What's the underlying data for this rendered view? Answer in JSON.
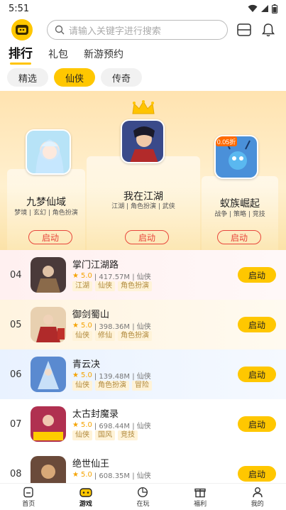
{
  "status": {
    "time": "5:51"
  },
  "header": {
    "search_placeholder": "请输入关键字进行搜索"
  },
  "tabs": [
    {
      "label": "排行",
      "active": true
    },
    {
      "label": "礼包",
      "active": false
    },
    {
      "label": "新游预约",
      "active": false
    }
  ],
  "chips": [
    {
      "label": "精选",
      "active": false
    },
    {
      "label": "仙侠",
      "active": true
    },
    {
      "label": "传奇",
      "active": false
    }
  ],
  "podium": [
    {
      "name": "九梦仙域",
      "tags": "梦境 | 玄幻 | 角色扮演",
      "button": "启动",
      "icon": "fairy-girl-icon"
    },
    {
      "name": "我在江湖",
      "tags": "江湖 | 角色扮演 | 武侠",
      "button": "启动",
      "icon": "swordsman-icon"
    },
    {
      "name": "蚁族崛起",
      "tags": "战争 | 策略 | 竞技",
      "button": "启动",
      "icon": "ant-warrior-icon",
      "badge": "0.05折"
    }
  ],
  "list": [
    {
      "rank": "04",
      "name": "掌门江湖路",
      "score": "5.0",
      "meta": "| 417.57M | 仙侠",
      "tags": [
        "江湖",
        "仙侠",
        "角色扮演"
      ],
      "button": "启动",
      "bg": "#fff3f3"
    },
    {
      "rank": "05",
      "name": "御剑蜀山",
      "score": "5.0",
      "meta": "| 398.36M | 仙侠",
      "tags": [
        "仙侠",
        "修仙",
        "角色扮演"
      ],
      "button": "启动",
      "bg": "#fff7e6"
    },
    {
      "rank": "06",
      "name": "青云决",
      "score": "5.0",
      "meta": "| 139.48M | 仙侠",
      "tags": [
        "仙侠",
        "角色扮演",
        "冒险"
      ],
      "button": "启动",
      "bg": "#eef5ff"
    },
    {
      "rank": "07",
      "name": "太古封魔录",
      "score": "5.0",
      "meta": "| 698.44M | 仙侠",
      "tags": [
        "仙侠",
        "国风",
        "竞技"
      ],
      "button": "启动",
      "bg": "#ffffff"
    },
    {
      "rank": "08",
      "name": "绝世仙王",
      "score": "5.0",
      "meta": "| 608.35M | 仙侠",
      "tags": [],
      "button": "启动",
      "bg": "#ffffff"
    }
  ],
  "nav": [
    {
      "label": "首页",
      "icon": "home-icon",
      "active": false
    },
    {
      "label": "游戏",
      "icon": "gamepad-icon",
      "active": true
    },
    {
      "label": "在玩",
      "icon": "play-icon",
      "active": false
    },
    {
      "label": "福利",
      "icon": "gift-icon",
      "active": false
    },
    {
      "label": "我的",
      "icon": "user-icon",
      "active": false
    }
  ],
  "colors": {
    "accent": "#ffc700",
    "start_outline": "#e8473c"
  }
}
